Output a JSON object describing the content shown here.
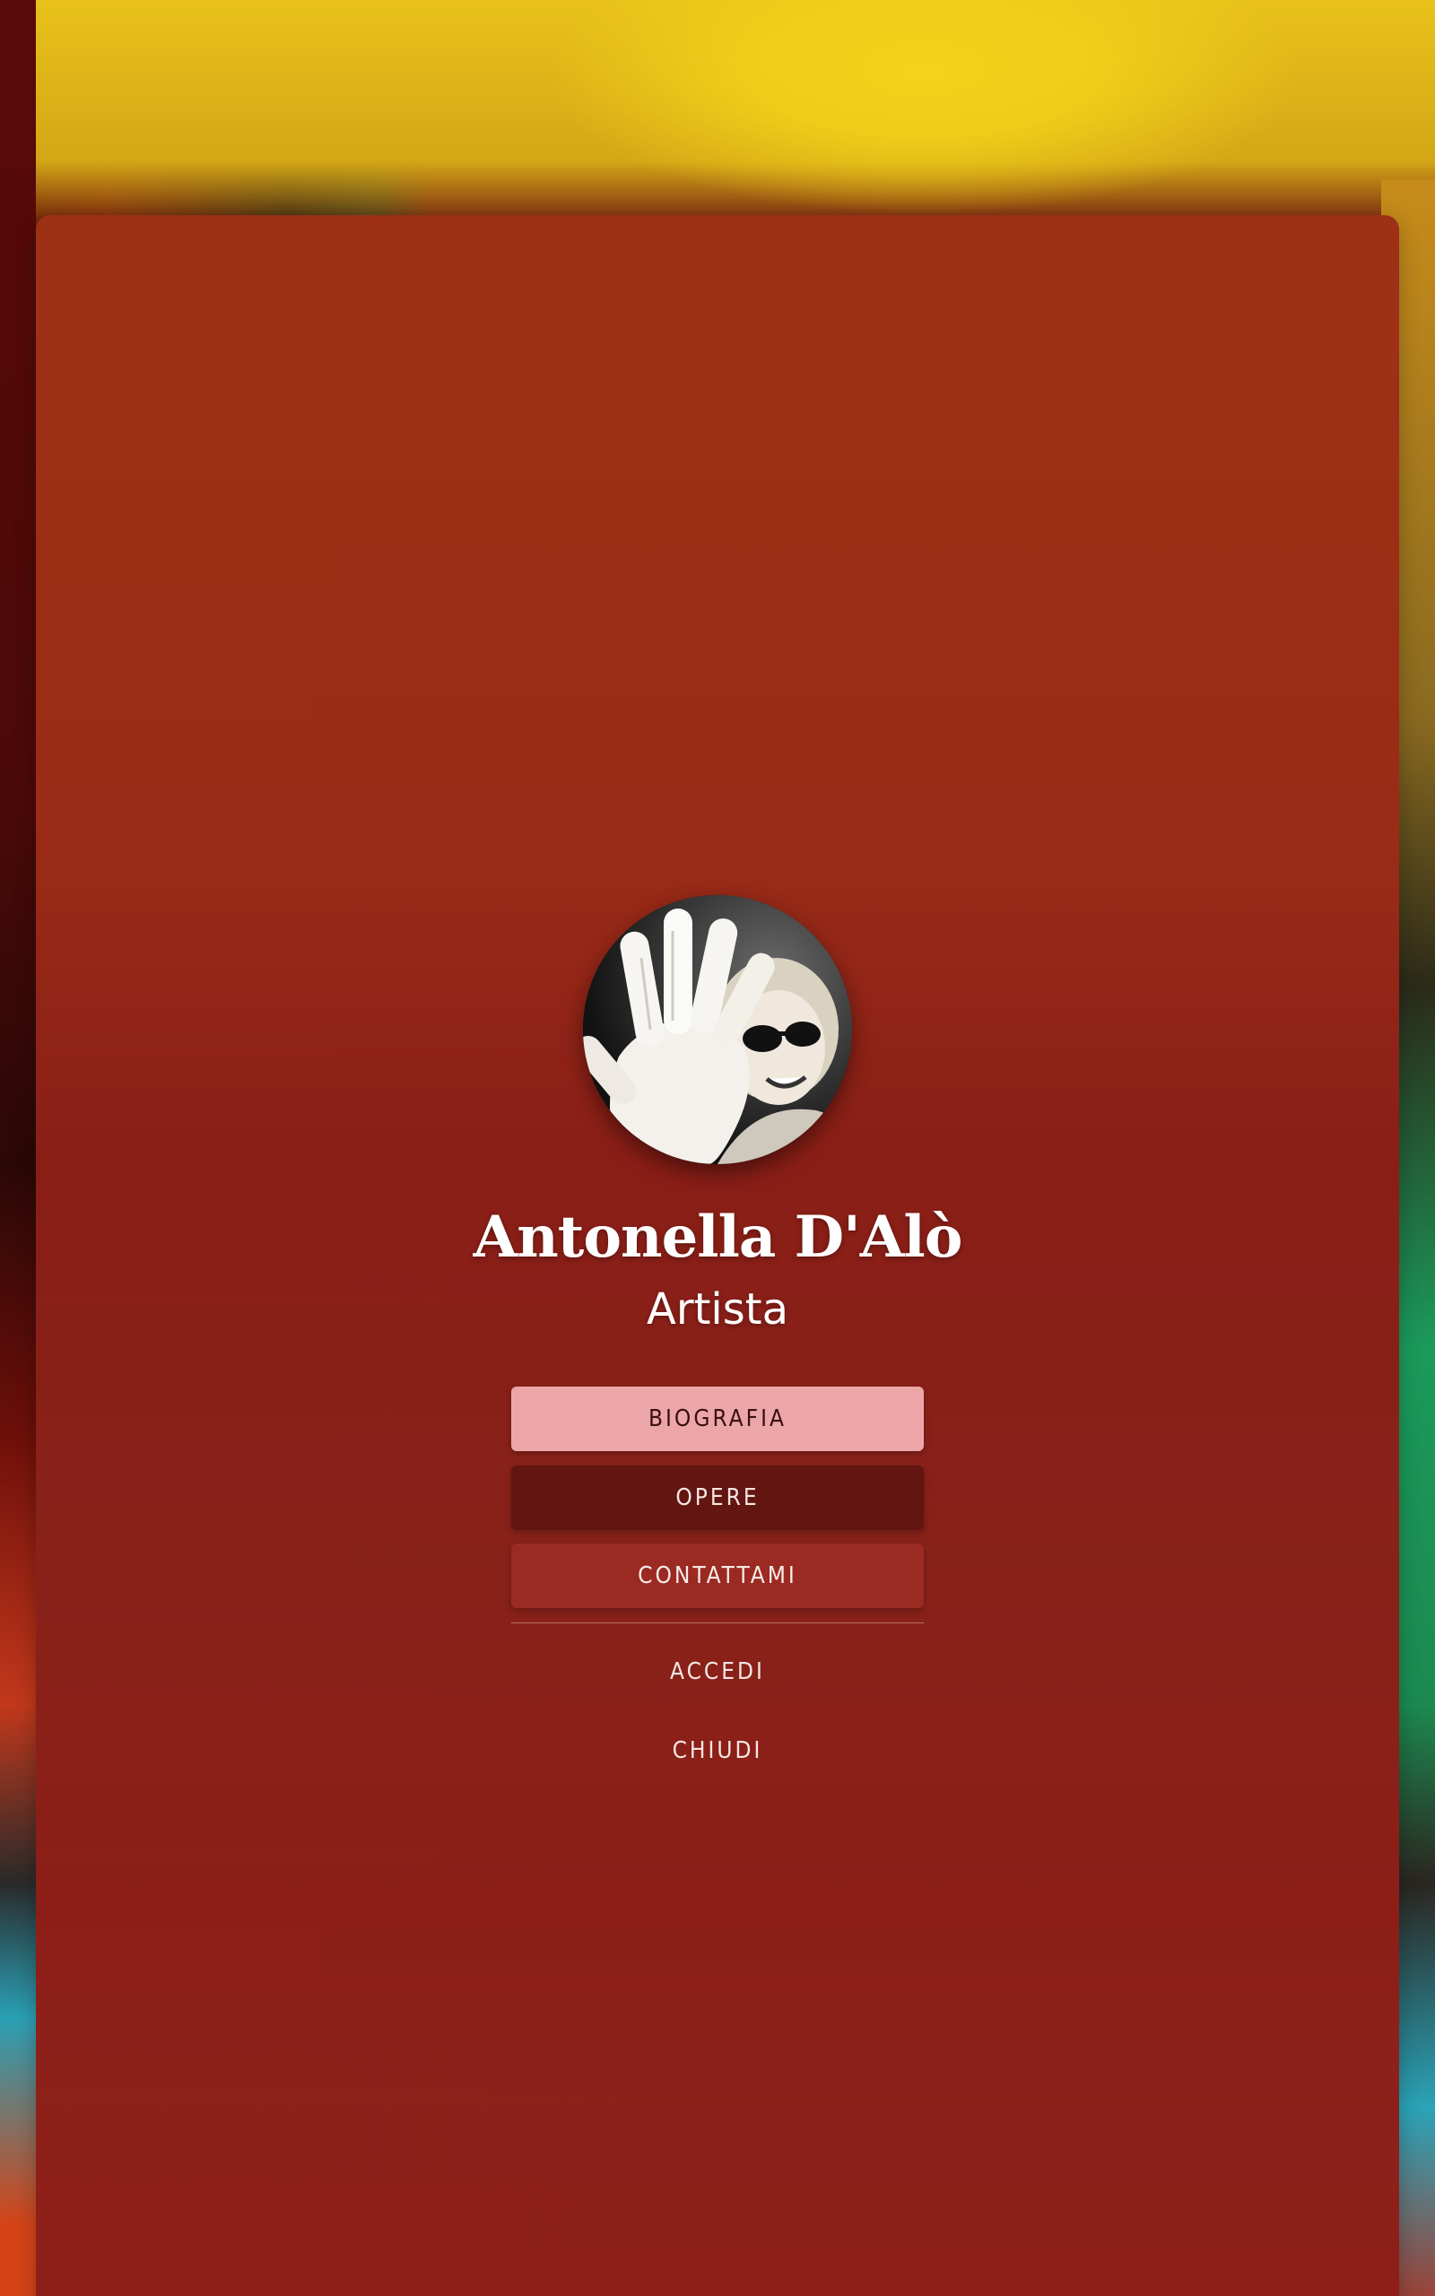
{
  "profile": {
    "name": "Antonella D'Alò",
    "role": "Artista"
  },
  "menu": {
    "biography_label": "BIOGRAFIA",
    "works_label": "OPERE",
    "contact_label": "CONTATTAMI",
    "login_label": "ACCEDI",
    "close_label": "CHIUDI"
  },
  "colors": {
    "card": "#8a2018",
    "biography_button": "#eda6a8",
    "works_button": "#621511",
    "contact_button": "#9b2a23",
    "text": "#ffffff"
  }
}
